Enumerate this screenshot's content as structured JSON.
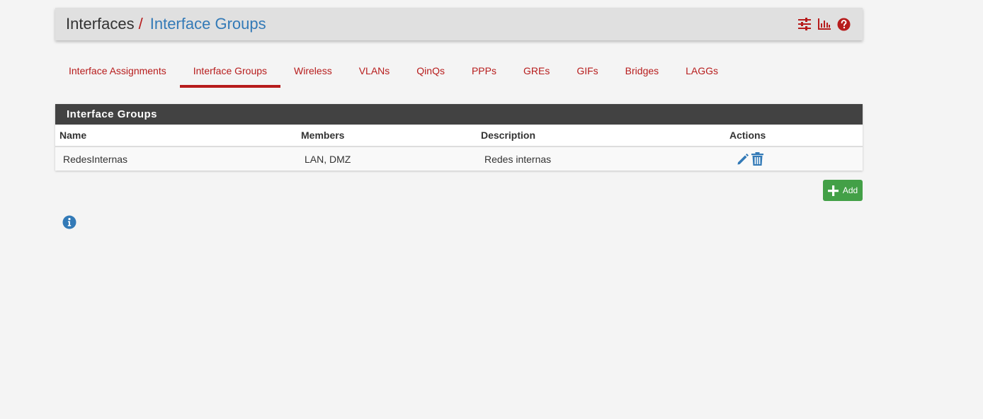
{
  "breadcrumb": {
    "root": "Interfaces",
    "separator": "/",
    "current": "Interface Groups"
  },
  "header_icons": [
    "settings-sliders-icon",
    "bar-chart-icon",
    "help-icon"
  ],
  "tabs": [
    {
      "label": "Interface Assignments",
      "active": false
    },
    {
      "label": "Interface Groups",
      "active": true
    },
    {
      "label": "Wireless",
      "active": false
    },
    {
      "label": "VLANs",
      "active": false
    },
    {
      "label": "QinQs",
      "active": false
    },
    {
      "label": "PPPs",
      "active": false
    },
    {
      "label": "GREs",
      "active": false
    },
    {
      "label": "GIFs",
      "active": false
    },
    {
      "label": "Bridges",
      "active": false
    },
    {
      "label": "LAGGs",
      "active": false
    }
  ],
  "panel": {
    "title": "Interface Groups",
    "columns": {
      "name": "Name",
      "members": "Members",
      "description": "Description",
      "actions": "Actions"
    },
    "rows": [
      {
        "name": "RedesInternas",
        "members": "LAN, DMZ",
        "description": "Redes internas"
      }
    ]
  },
  "add_button": {
    "label": "Add"
  },
  "colors": {
    "accent_red": "#b71c1c",
    "link_blue": "#337ab7",
    "panel_heading": "#424242",
    "add_green": "#43a047"
  }
}
